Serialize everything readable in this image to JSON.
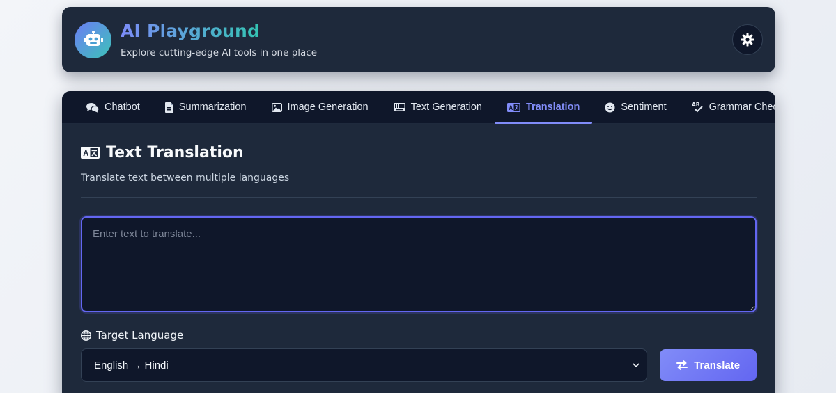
{
  "app": {
    "title": "AI Playground",
    "subtitle": "Explore cutting-edge AI tools in one place"
  },
  "tabs": [
    {
      "label": "Chatbot",
      "icon": "chat-bubbles-icon"
    },
    {
      "label": "Summarization",
      "icon": "file-icon"
    },
    {
      "label": "Image Generation",
      "icon": "image-icon"
    },
    {
      "label": "Text Generation",
      "icon": "keyboard-icon"
    },
    {
      "label": "Translation",
      "icon": "language-icon",
      "active": true
    },
    {
      "label": "Sentiment",
      "icon": "smiley-icon"
    },
    {
      "label": "Grammar Check",
      "icon": "spell-check-icon"
    }
  ],
  "section": {
    "title": "Text Translation",
    "subtitle": "Translate text between multiple languages"
  },
  "input": {
    "placeholder": "Enter text to translate...",
    "value": ""
  },
  "target_language": {
    "label": "Target Language",
    "selected": "English → Hindi"
  },
  "translate_button": {
    "label": "Translate"
  },
  "colors": {
    "accent": "#818cf8",
    "card_bg": "#1e293b",
    "input_bg": "#0f172a",
    "brand_gradient_start": "#7c8cf8",
    "brand_gradient_end": "#34c3b4"
  }
}
